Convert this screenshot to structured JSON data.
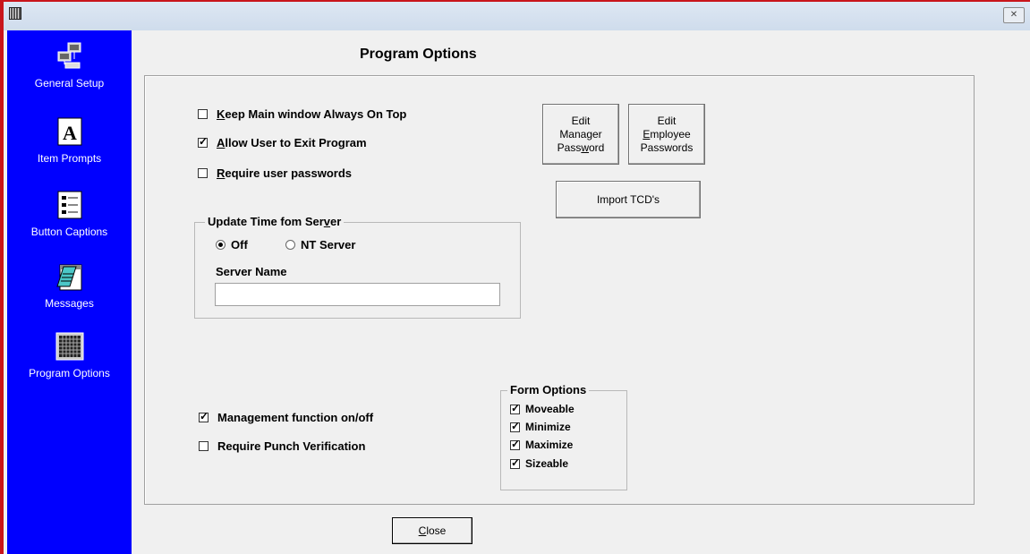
{
  "window": {
    "close_glyph": "✕"
  },
  "sidebar": {
    "items": [
      {
        "label": "General Setup",
        "icon": "computer-network-icon"
      },
      {
        "label": "Item Prompts",
        "icon": "font-a-icon"
      },
      {
        "label": "Button Captions",
        "icon": "list-form-icon"
      },
      {
        "label": "Messages",
        "icon": "notepad-icon"
      },
      {
        "label": "Program Options",
        "icon": "calculator-grid-icon"
      }
    ]
  },
  "main": {
    "title": "Program Options",
    "options": {
      "keep_on_top": {
        "pre": "",
        "key": "K",
        "post": "eep Main window Always On Top",
        "checked": false
      },
      "allow_exit": {
        "pre": "",
        "key": "A",
        "post": "llow User to Exit Program",
        "checked": true
      },
      "require_pw": {
        "pre": "",
        "key": "R",
        "post": "equire user passwords",
        "checked": false
      },
      "mgmt_func": {
        "label": "Management function on/off",
        "checked": true
      },
      "punch_verify": {
        "label": "Require Punch Verification",
        "checked": false
      }
    },
    "buttons": {
      "edit_manager": {
        "l1": "Edit",
        "l2": "Manager",
        "l3a": "Pass",
        "l3k": "w",
        "l3b": "ord"
      },
      "edit_employee": {
        "l1": "Edit",
        "l2k": "E",
        "l2b": "mployee",
        "l3": "Passwords"
      },
      "import": "Import TCD's"
    },
    "time_group": {
      "legend_a": "Update Time fom Ser",
      "legend_k": "v",
      "legend_b": "er",
      "radio_off": "Off",
      "radio_nt": "NT Server",
      "selected": "Off",
      "server_label": "Server Name",
      "server_value": ""
    },
    "form_options": {
      "legend": "Form Options",
      "items": [
        {
          "label": "Moveable",
          "checked": true
        },
        {
          "label": "Minimize",
          "checked": true
        },
        {
          "label": "Maximize",
          "checked": true
        },
        {
          "label": "Sizeable",
          "checked": true
        }
      ]
    },
    "close": {
      "key": "C",
      "rest": "lose"
    }
  }
}
